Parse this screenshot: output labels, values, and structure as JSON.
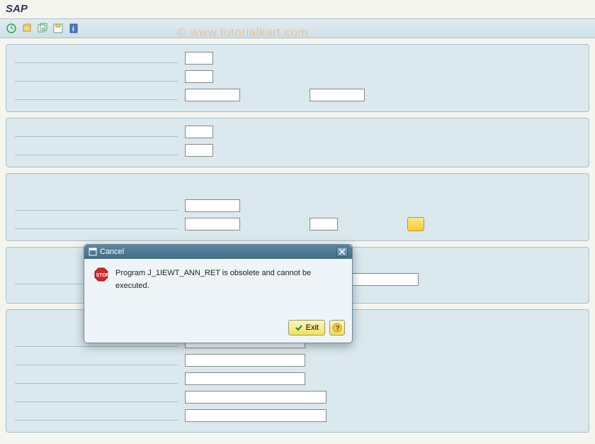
{
  "window": {
    "title": "SAP"
  },
  "watermark": "© www.tutorialkart.com",
  "toolbar": {
    "icons": [
      "execute-icon",
      "get-variant-icon",
      "variant-attributes-icon",
      "save-variant-icon",
      "info-icon"
    ]
  },
  "dialog": {
    "title": "Cancel",
    "message": "Program J_1IEWT_ANN_RET is obsolete and cannot be executed.",
    "exit_label": "Exit"
  }
}
